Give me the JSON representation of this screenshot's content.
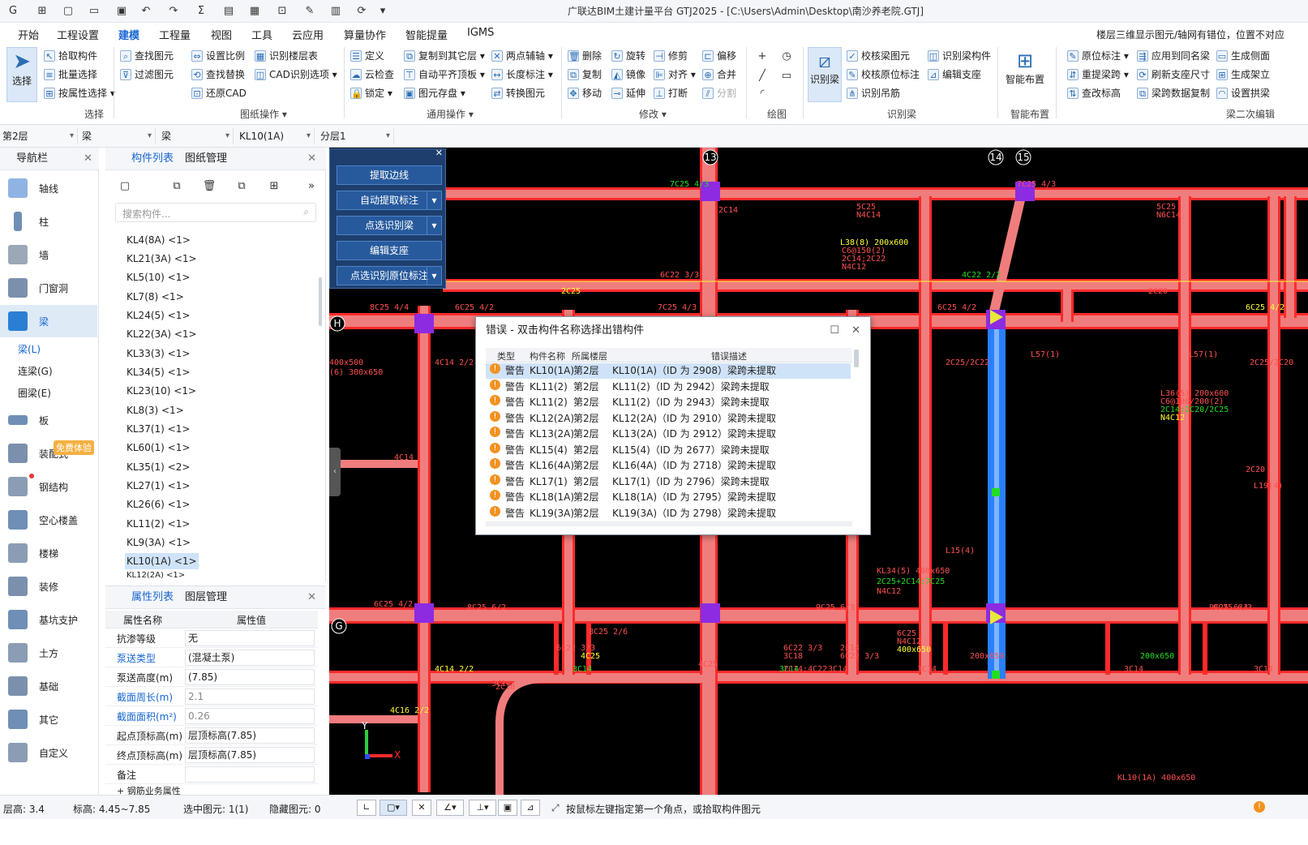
{
  "app": {
    "title": "广联达BIM土建计量平台 GTJ2025 - [C:\\Users\\Admin\\Desktop\\南沙养老院.GTJ]"
  },
  "menu": {
    "items": [
      "开始",
      "工程设置",
      "建模",
      "工程量",
      "视图",
      "工具",
      "云应用",
      "算量协作",
      "智能提量",
      "IGMS"
    ],
    "active": "建模",
    "right_text": "楼层三维显示图元/轴网有错位，位置不对应"
  },
  "ribbon": {
    "select_group": {
      "big": "选择",
      "items": [
        "拾取构件",
        "批量选择",
        "按属性选择"
      ],
      "label": "选择"
    },
    "drawing_ops": {
      "items": [
        "查找图元",
        "过滤图元",
        "设置比例",
        "识别楼层表",
        "查找替换",
        "CAD识别选项",
        "还原CAD"
      ],
      "label": "图纸操作"
    },
    "common_ops": {
      "items": [
        "定义",
        "复制到其它层",
        "两点辅轴",
        "云检查",
        "自动平齐顶板",
        "长度标注",
        "锁定",
        "图元存盘",
        "转换图元"
      ],
      "label": "通用操作"
    },
    "modify": {
      "items": [
        "删除",
        "旋转",
        "修剪",
        "偏移",
        "复制",
        "镜像",
        "对齐",
        "合并",
        "移动",
        "延伸",
        "打断",
        "分割"
      ],
      "label": "修改"
    },
    "draw": {
      "label": "绘图"
    },
    "recognize_beam": {
      "big": "识别梁",
      "items": [
        "校核梁图元",
        "识别梁构件",
        "校核原位标注",
        "编辑支座",
        "识别吊筋"
      ],
      "label": "识别梁"
    },
    "smart": {
      "big": "智能布置",
      "label": "智能布置"
    },
    "beam_edit": {
      "items": [
        "原位标注",
        "应用到同名梁",
        "生成侧面",
        "重提梁跨",
        "刷新支座尺寸",
        "生成架立",
        "查改标高",
        "梁跨数据复制",
        "设置拱梁"
      ],
      "label": "梁二次编辑"
    }
  },
  "selectors": [
    "第2层",
    "梁",
    "梁",
    "KL10(1A)",
    "分层1"
  ],
  "nav": {
    "title": "导航栏",
    "items": [
      "轴线",
      "柱",
      "墙",
      "门窗洞",
      "梁",
      "板",
      "装配式",
      "钢结构",
      "空心楼盖",
      "楼梯",
      "装修",
      "基坑支护",
      "土方",
      "基础",
      "其它",
      "自定义"
    ],
    "sub_items": [
      "梁(L)",
      "连梁(G)",
      "圈梁(E)"
    ],
    "badge": "免费体验"
  },
  "component_list": {
    "tabs": [
      "构件列表",
      "图纸管理"
    ],
    "search_placeholder": "搜索构件...",
    "items": [
      "KL4(8A) <1>",
      "KL21(3A) <1>",
      "KL5(10) <1>",
      "KL7(8) <1>",
      "KL24(5) <1>",
      "KL22(3A) <1>",
      "KL33(3) <1>",
      "KL34(5) <1>",
      "KL23(10) <1>",
      "KL8(3) <1>",
      "KL37(1) <1>",
      "KL60(1) <1>",
      "KL35(1) <2>",
      "KL27(1) <1>",
      "KL26(6) <1>",
      "KL11(2) <1>",
      "KL9(3A) <1>",
      "KL10(1A) <1>",
      "KL12(2A) <1>"
    ],
    "selected": "KL10(1A) <1>"
  },
  "properties": {
    "tabs": [
      "属性列表",
      "图层管理"
    ],
    "headers": [
      "属性名称",
      "属性值"
    ],
    "rows": [
      {
        "name": "抗渗等级",
        "value": "无"
      },
      {
        "name": "泵送类型",
        "value": "(混凝土泵)"
      },
      {
        "name": "泵送高度(m)",
        "value": "(7.85)"
      },
      {
        "name": "截面周长(m)",
        "value": "2.1"
      },
      {
        "name": "截面面积(m²)",
        "value": "0.26"
      },
      {
        "name": "起点顶标高(m)",
        "value": "层顶标高(7.85)"
      },
      {
        "name": "终点顶标高(m)",
        "value": "层顶标高(7.85)"
      },
      {
        "name": "备注",
        "value": ""
      },
      {
        "name": "钢筋业务属性",
        "value": ""
      }
    ]
  },
  "float_panel": {
    "buttons": [
      "提取边线",
      "自动提取标注",
      "点选识别梁",
      "编辑支座",
      "点选识别原位标注"
    ]
  },
  "error_dialog": {
    "title": "错误 - 双击构件名称选择出错构件",
    "headers": [
      "类型",
      "构件名称",
      "所属楼层",
      "错误描述"
    ],
    "rows": [
      {
        "type": "警告",
        "name": "KL10(1A)",
        "floor": "第2层",
        "desc": "KL10(1A)（ID 为 2908）梁跨未提取"
      },
      {
        "type": "警告",
        "name": "KL11(2)",
        "floor": "第2层",
        "desc": "KL11(2)（ID 为 2942）梁跨未提取"
      },
      {
        "type": "警告",
        "name": "KL11(2)",
        "floor": "第2层",
        "desc": "KL11(2)（ID 为 2943）梁跨未提取"
      },
      {
        "type": "警告",
        "name": "KL12(2A)",
        "floor": "第2层",
        "desc": "KL12(2A)（ID 为 2910）梁跨未提取"
      },
      {
        "type": "警告",
        "name": "KL13(2A)",
        "floor": "第2层",
        "desc": "KL13(2A)（ID 为 2912）梁跨未提取"
      },
      {
        "type": "警告",
        "name": "KL15(4)",
        "floor": "第2层",
        "desc": "KL15(4)（ID 为 2677）梁跨未提取"
      },
      {
        "type": "警告",
        "name": "KL16(4A)",
        "floor": "第2层",
        "desc": "KL16(4A)（ID 为 2718）梁跨未提取"
      },
      {
        "type": "警告",
        "name": "KL17(1)",
        "floor": "第2层",
        "desc": "KL17(1)（ID 为 2796）梁跨未提取"
      },
      {
        "type": "警告",
        "name": "KL18(1A)",
        "floor": "第2层",
        "desc": "KL18(1A)（ID 为 2795）梁跨未提取"
      },
      {
        "type": "警告",
        "name": "KL19(3A)",
        "floor": "第2层",
        "desc": "KL19(3A)（ID 为 2798）梁跨未提取"
      }
    ]
  },
  "canvas": {
    "axis_labels": [
      "13",
      "14",
      "15",
      "H",
      "G"
    ],
    "texts": [
      "7C25 4/3",
      "7C25 4/3",
      "5C25",
      "N4C14",
      "5C25",
      "N6C14",
      "6C22 3/3",
      "2C25",
      "7C25 4/3",
      "4C22 2/2",
      "2C20",
      "6C25 4/2",
      "8C25 4/4",
      "6C25 4/2",
      "6C25 4/2",
      "4C14 2/2",
      "2C25/2C22",
      "2C25/2C20",
      "L57(1)",
      "L57(1)",
      "L57(1)",
      "L38(8) 200x600",
      "C6@150(2)",
      "2C14;2C22",
      "N4C12",
      "L36(5) 200x600",
      "C6@100/200(2)",
      "2C14;2C20/2C25",
      "N4C12",
      "4C14",
      "8C25 6/2",
      "9C25 6/3",
      "9C25 6/3",
      "9C25 6/3",
      "8C25 2/6",
      "4C14 2/2",
      "3C14",
      "3C14",
      "3C14",
      "3C14",
      "3C14",
      "2C18",
      "4C16 2/2",
      "6C25 4/2",
      "KL34(5) 400x650",
      "2C25+2C14;7C25",
      "N4C12",
      "6C25",
      "N4C12",
      "400x650",
      "6C22 3/3",
      "6C22 3/3",
      "3C18",
      "200x650",
      "200x650",
      "4C25",
      "4C25",
      "2C14",
      "6C22 3/3",
      "2C14",
      "400x500",
      "(6) 300x650",
      "2C14;4C22",
      "3C14",
      "3C14",
      "2C20",
      "L19(4)",
      "L15(4)",
      "KL10(1A) 400x650"
    ]
  },
  "status": {
    "floor_height": "层高: 3.4",
    "elevation": "标高: 4.45~7.85",
    "selected": "选中图元: 1(1)",
    "hidden": "隐藏图元: 0",
    "hint": "按鼠标左键指定第一个角点，或拾取构件图元"
  },
  "colors": {
    "accent": "#1967d2",
    "beam_red": "#ff2a2a",
    "beam_pink": "#f07d7d",
    "column_purple": "#8c2be2",
    "selected_beam": "#2a7fff",
    "warning": "#f39221",
    "panel_blue": "#1e3f6e"
  }
}
